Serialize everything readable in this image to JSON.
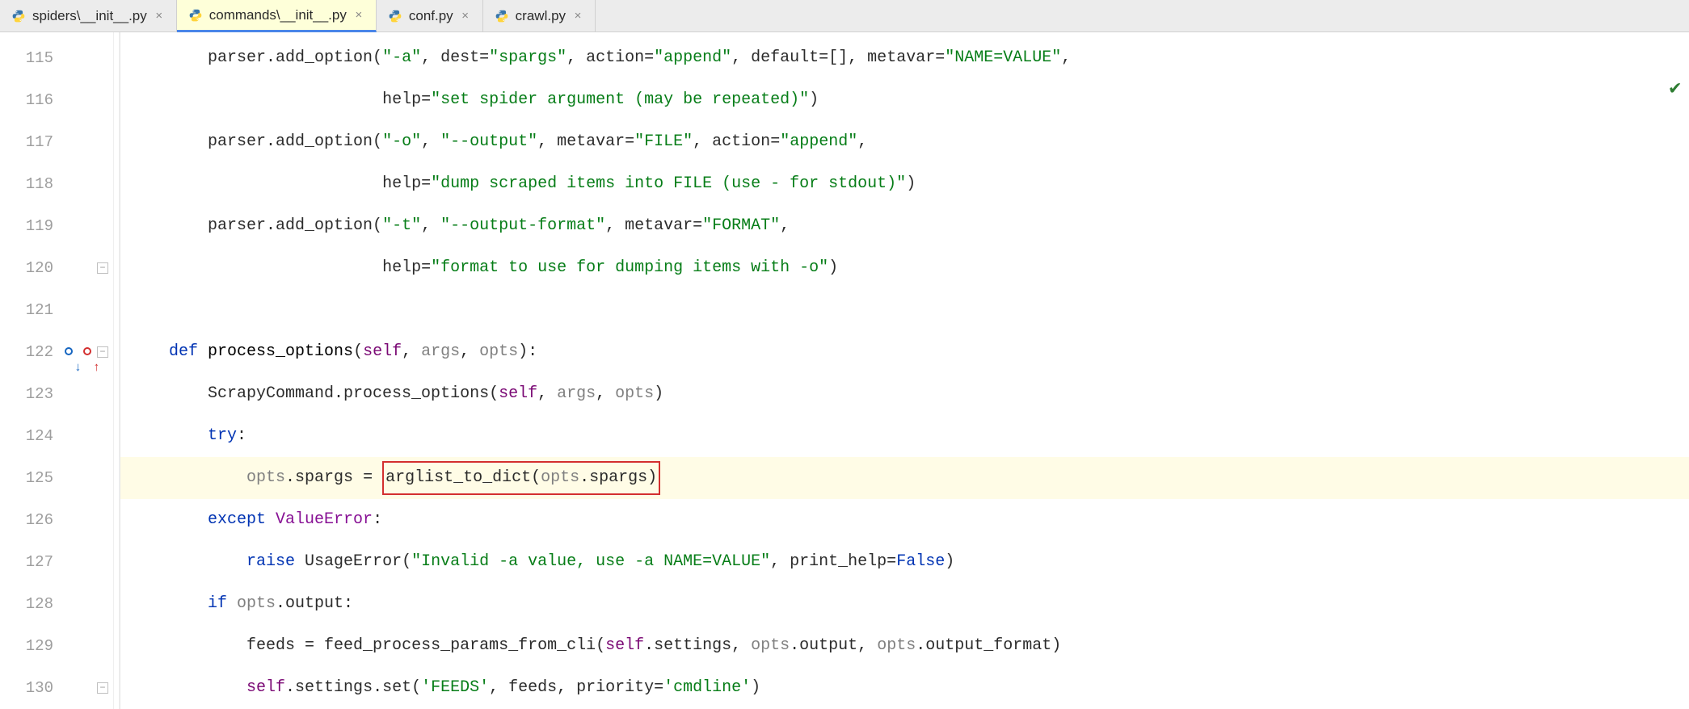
{
  "tabs": [
    {
      "label": "spiders\\__init__.py",
      "active": false
    },
    {
      "label": "commands\\__init__.py",
      "active": true
    },
    {
      "label": "conf.py",
      "active": false
    },
    {
      "label": "crawl.py",
      "active": false
    }
  ],
  "gutter": {
    "lines": [
      "115",
      "116",
      "117",
      "118",
      "119",
      "120",
      "121",
      "122",
      "123",
      "124",
      "125",
      "126",
      "127",
      "128",
      "129",
      "130"
    ]
  },
  "code": {
    "l115": {
      "t1": "parser.add_option(",
      "s1": "\"-a\"",
      "t2": ", dest=",
      "s2": "\"spargs\"",
      "t3": ", action=",
      "s3": "\"append\"",
      "t4": ", default=[], metavar=",
      "s4": "\"NAME=VALUE\"",
      "t5": ","
    },
    "l116": {
      "t1": "help=",
      "s1": "\"set spider argument (may be repeated)\"",
      "t2": ")"
    },
    "l117": {
      "t1": "parser.add_option(",
      "s1": "\"-o\"",
      "t2": ", ",
      "s2": "\"--output\"",
      "t3": ", metavar=",
      "s3": "\"FILE\"",
      "t4": ", action=",
      "s4": "\"append\"",
      "t5": ","
    },
    "l118": {
      "t1": "help=",
      "s1": "\"dump scraped items into FILE (use - for stdout)\"",
      "t2": ")"
    },
    "l119": {
      "t1": "parser.add_option(",
      "s1": "\"-t\"",
      "t2": ", ",
      "s2": "\"--output-format\"",
      "t3": ", metavar=",
      "s3": "\"FORMAT\"",
      "t4": ","
    },
    "l120": {
      "t1": "help=",
      "s1": "\"format to use for dumping items with -o\"",
      "t2": ")"
    },
    "l122": {
      "kw": "def ",
      "name": "process_options",
      "open": "(",
      "p1": "self",
      "c1": ", ",
      "p2": "args",
      "c2": ", ",
      "p3": "opts",
      "close": "):"
    },
    "l123": {
      "t1": "ScrapyCommand.process_options(",
      "p1": "self",
      "c1": ", ",
      "p2": "args",
      "c2": ", ",
      "p3": "opts",
      "t2": ")"
    },
    "l124": {
      "kw": "try",
      "t": ":"
    },
    "l125": {
      "p1": "opts",
      "t1": ".spargs = ",
      "box_fn": "arglist_to_dict(",
      "box_p": "opts",
      "box_t": ".spargs)"
    },
    "l126": {
      "kw": "except ",
      "exc": "ValueError",
      "t": ":"
    },
    "l127": {
      "kw": "raise ",
      "cls": "UsageError(",
      "s1": "\"Invalid -a value, use -a NAME=VALUE\"",
      "t1": ", print_help=",
      "bool": "False",
      "t2": ")"
    },
    "l128": {
      "kw": "if ",
      "p1": "opts",
      "t1": ".output:"
    },
    "l129": {
      "t1": "feeds = feed_process_params_from_cli(",
      "p1": "self",
      "t2": ".settings, ",
      "p2": "opts",
      "t3": ".output, ",
      "p3": "opts",
      "t4": ".output_format)"
    },
    "l130": {
      "p1": "self",
      "t1": ".settings.set(",
      "s1": "'FEEDS'",
      "t2": ", feeds, priority=",
      "s2": "'cmdline'",
      "t3": ")"
    }
  },
  "status": {
    "ok": "✔"
  }
}
